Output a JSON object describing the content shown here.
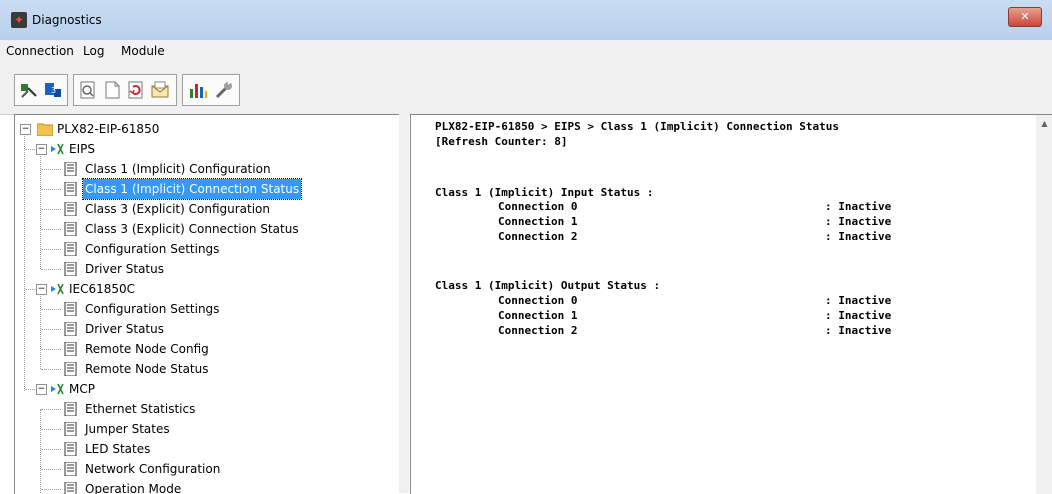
{
  "window": {
    "title": "Diagnostics",
    "close_label": "✕"
  },
  "menu": {
    "items": [
      "Connection",
      "Log",
      "Module"
    ]
  },
  "toolbar": {
    "groups": [
      {
        "buttons": [
          "connect-icon",
          "disconnect-icon"
        ]
      },
      {
        "buttons": [
          "find-icon",
          "page-icon",
          "refresh-icon",
          "mail-icon"
        ]
      },
      {
        "buttons": [
          "chart-icon",
          "wrench-icon"
        ]
      }
    ]
  },
  "tree": {
    "root": "PLX82-EIP-61850",
    "eips": "EIPS",
    "eips_items": [
      "Class 1 (Implicit) Configuration",
      "Class 1 (Implicit) Connection Status",
      "Class 3 (Explicit) Configuration",
      "Class 3 (Explicit) Connection Status",
      "Configuration Settings",
      "Driver Status"
    ],
    "iec": "IEC61850C",
    "iec_items": [
      "Configuration Settings",
      "Driver Status",
      "Remote Node Config",
      "Remote Node Status"
    ],
    "mcp": "MCP",
    "mcp_items": [
      "Ethernet Statistics",
      "Jumper States",
      "LED States",
      "Network Configuration",
      "Operation Mode"
    ],
    "selected": "Class 1 (Implicit) Connection Status"
  },
  "output": {
    "path": "PLX82-EIP-61850 > EIPS > Class 1 (Implicit) Connection Status",
    "refresh_counter": "[Refresh Counter: 8]",
    "input_header": "Class 1 (Implicit) Input Status :",
    "input_rows": [
      {
        "name": "Connection 0",
        "value": ": Inactive"
      },
      {
        "name": "Connection 1",
        "value": ": Inactive"
      },
      {
        "name": "Connection 2",
        "value": ": Inactive"
      }
    ],
    "output_header": "Class 1 (Implicit) Output Status :",
    "output_rows": [
      {
        "name": "Connection 0",
        "value": ": Inactive"
      },
      {
        "name": "Connection 1",
        "value": ": Inactive"
      },
      {
        "name": "Connection 2",
        "value": ": Inactive"
      }
    ]
  },
  "colors": {
    "selection": "#3399ff",
    "titlebar": "#c9dcf2"
  }
}
